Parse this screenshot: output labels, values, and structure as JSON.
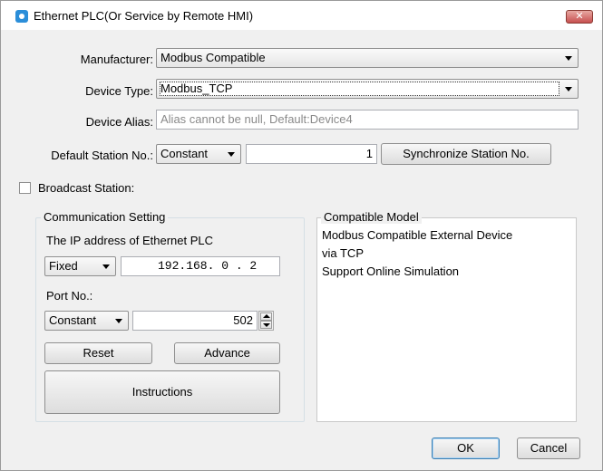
{
  "window": {
    "title": "Ethernet PLC(Or Service by Remote HMI)",
    "close_glyph": "✕",
    "icon": "app-icon"
  },
  "form": {
    "manufacturer_label": "Manufacturer:",
    "manufacturer_value": "Modbus Compatible",
    "device_type_label": "Device Type:",
    "device_type_value": "Modbus_TCP",
    "device_alias_label": "Device Alias:",
    "device_alias_placeholder": "Alias cannot be null, Default:Device4",
    "station_label": "Default Station No.:",
    "station_mode_value": "Constant",
    "station_number": "1",
    "sync_button": "Synchronize Station No.",
    "broadcast_label": "Broadcast Station:",
    "broadcast_checked": false
  },
  "communication": {
    "legend": "Communication Setting",
    "ip_label": "The IP address of Ethernet PLC",
    "ip_mode_value": "Fixed",
    "ip_address": "192.168. 0 . 2",
    "port_label": "Port No.:",
    "port_mode_value": "Constant",
    "port_value": "502",
    "reset_button": "Reset",
    "advance_button": "Advance",
    "instructions_button": "Instructions"
  },
  "compatible": {
    "legend": "Compatible Model",
    "lines": [
      "Modbus Compatible External Device",
      "via TCP",
      "Support Online Simulation"
    ]
  },
  "footer": {
    "ok_button": "OK",
    "cancel_button": "Cancel"
  }
}
